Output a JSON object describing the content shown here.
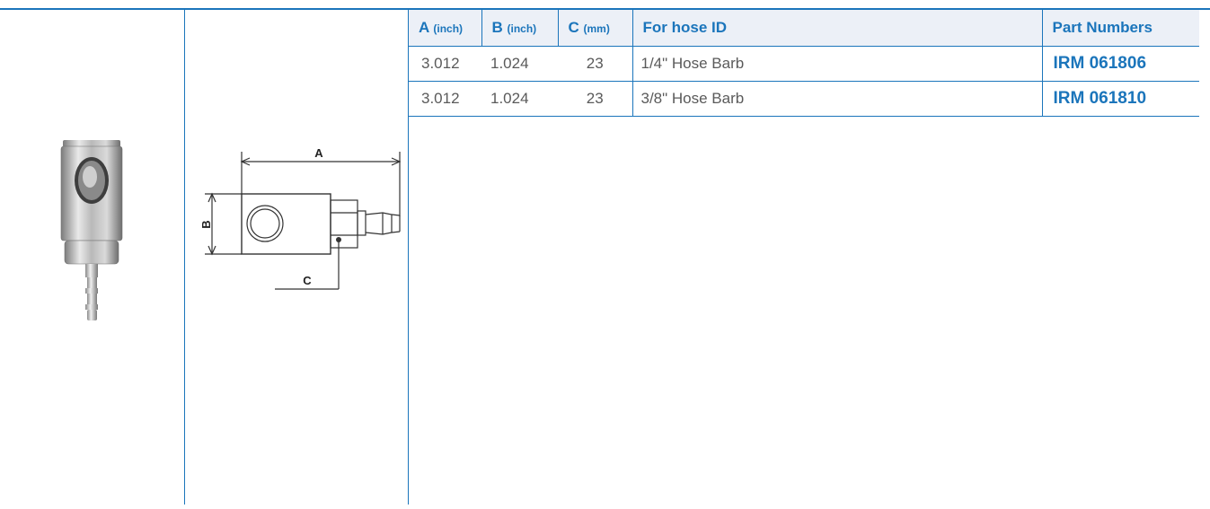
{
  "table": {
    "headers": [
      {
        "letter": "A",
        "unit": "(inch)"
      },
      {
        "letter": "B",
        "unit": "(inch)"
      },
      {
        "letter": "C",
        "unit": "(mm)"
      },
      {
        "letter": "For hose ID",
        "unit": ""
      },
      {
        "letter": "Part Numbers",
        "unit": ""
      }
    ],
    "rows": [
      {
        "a": "3.012",
        "b": "1.024",
        "c": "23",
        "hose": "1/4\" Hose Barb",
        "part": "IRM 061806"
      },
      {
        "a": "3.012",
        "b": "1.024",
        "c": "23",
        "hose": "3/8\" Hose Barb",
        "part": "IRM 061810"
      }
    ]
  },
  "drawing": {
    "label_a": "A",
    "label_b": "B",
    "label_c": "C"
  },
  "colors": {
    "accent": "#1b75bb",
    "header_bg": "#ecf0f7",
    "cell_text": "#5a5a5a"
  }
}
